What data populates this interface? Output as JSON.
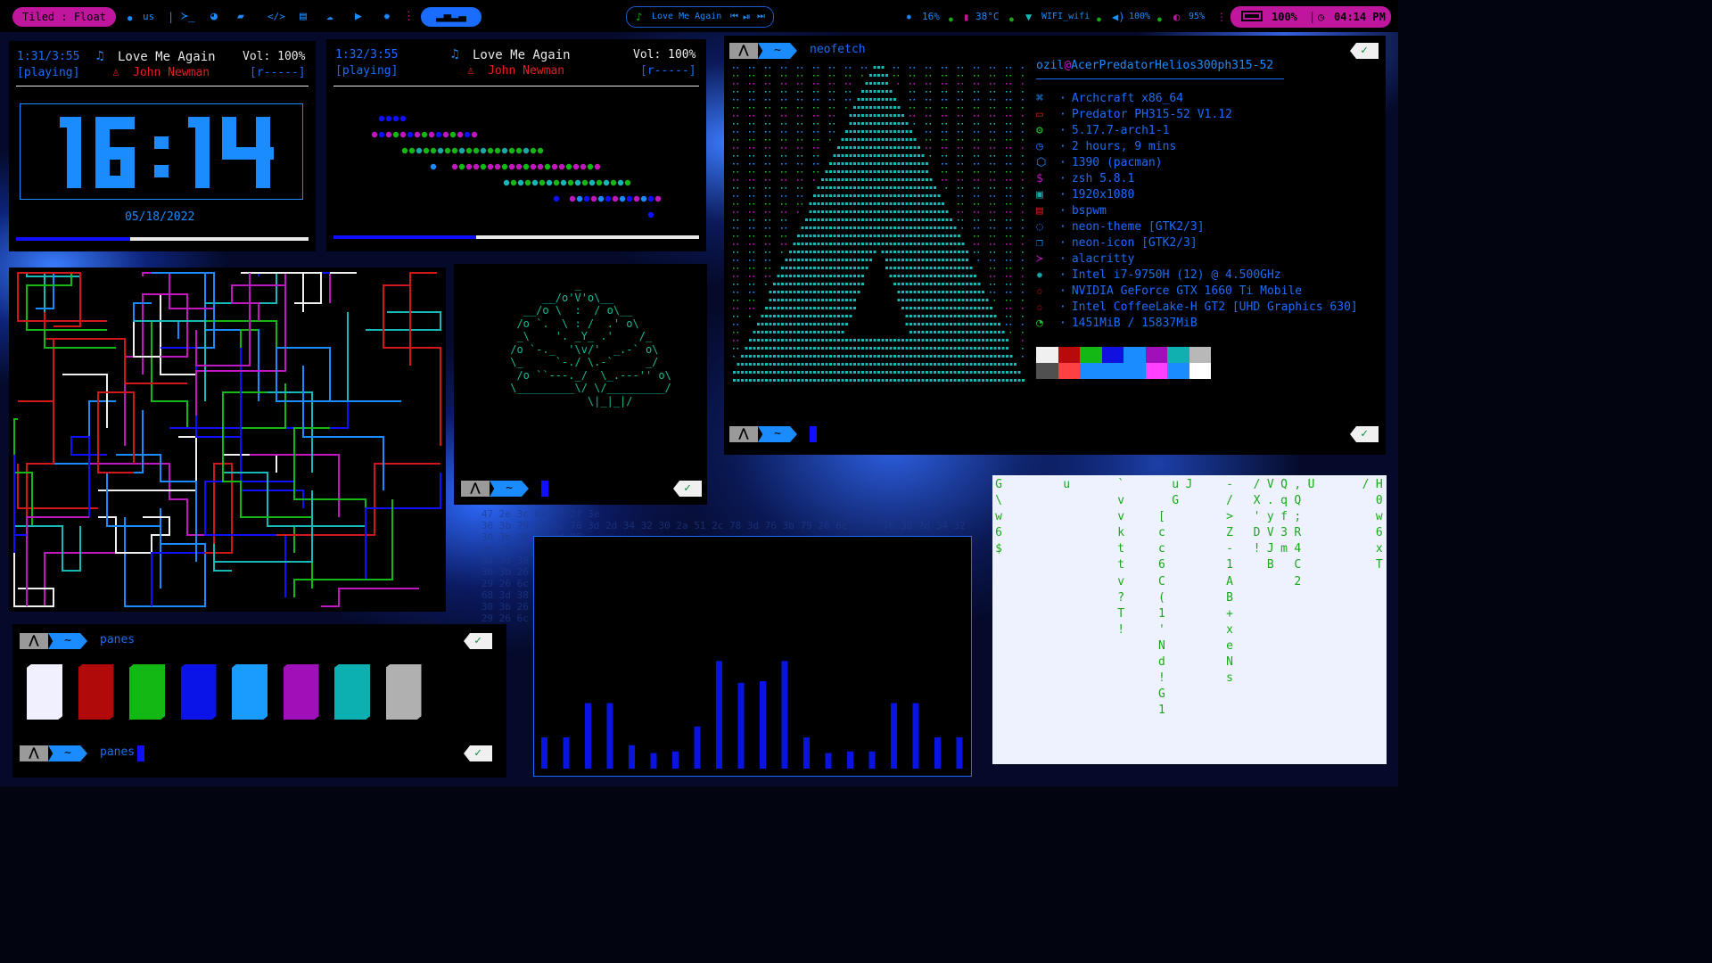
{
  "bar": {
    "layout_label": "Tiled : Float",
    "keyboard": "us",
    "now_playing": "Love Me Again",
    "cpu": "16%",
    "temp": "38°C",
    "wifi": "WIFI_wifi",
    "volume": "100%",
    "brightness": "95%",
    "battery": "100%",
    "clock": "04:14 PM",
    "accent": "#1a8cff",
    "highlight": "#c0169e"
  },
  "player1": {
    "time": "1:31/3:55",
    "state": "[playing]",
    "title": "Love Me Again",
    "artist": "John Newman",
    "volume": "Vol: 100%",
    "flags": "[r-----]",
    "progress": 0.39
  },
  "clock_widget": {
    "time": "16:14",
    "date": "05/18/2022"
  },
  "player2": {
    "time": "1:32/3:55",
    "state": "[playing]",
    "title": "Love Me Again",
    "artist": "John Newman",
    "volume": "Vol: 100%",
    "flags": "[r-----]",
    "progress": 0.39
  },
  "neofetch": {
    "command": "neofetch",
    "user_host_user": "ozil",
    "user_host_sep": "@",
    "user_host_host": "AcerPredatorHelios300ph315-52",
    "info": [
      {
        "icon": "⌘",
        "icon_name": "command-icon",
        "color": "#1a8cff",
        "value": "Archcraft x86_64"
      },
      {
        "icon": "▭",
        "icon_name": "laptop-icon",
        "color": "#d01818",
        "value": "Predator PH315-52 V1.12"
      },
      {
        "icon": "⚙",
        "icon_name": "kernel-gear-icon",
        "color": "#22c022",
        "value": "5.17.7-arch1-1"
      },
      {
        "icon": "◷",
        "icon_name": "uptime-clock-icon",
        "color": "#1a6cff",
        "value": "2 hours, 9 mins"
      },
      {
        "icon": "⬡",
        "icon_name": "package-icon",
        "color": "#1a8cff",
        "value": "1390 (pacman)"
      },
      {
        "icon": "$",
        "icon_name": "shell-icon",
        "color": "#c018c0",
        "value": "zsh 5.8.1"
      },
      {
        "icon": "▣",
        "icon_name": "resolution-icon",
        "color": "#18a8a8",
        "value": "1920x1080"
      },
      {
        "icon": "▤",
        "icon_name": "wm-icon",
        "color": "#d01818",
        "value": "bspwm"
      },
      {
        "icon": "◌",
        "icon_name": "theme-icon",
        "color": "#1a6cff",
        "value": "neon-theme [GTK2/3]"
      },
      {
        "icon": "❐",
        "icon_name": "icons-icon",
        "color": "#1a8cff",
        "value": "neon-icon [GTK2/3]"
      },
      {
        "icon": "≻",
        "icon_name": "terminal-icon",
        "color": "#c018c0",
        "value": "alacritty"
      },
      {
        "icon": "✹",
        "icon_name": "cpu-icon",
        "color": "#18a8a8",
        "value": "Intel i7-9750H (12) @ 4.500GHz"
      },
      {
        "icon": "✩",
        "icon_name": "gpu-icon",
        "color": "#d01818",
        "value": "NVIDIA GeForce GTX 1660 Ti Mobile"
      },
      {
        "icon": "✩",
        "icon_name": "gpu-icon",
        "color": "#d01818",
        "value": "Intel CoffeeLake-H GT2 [UHD Graphics 630]"
      },
      {
        "icon": "◔",
        "icon_name": "memory-icon",
        "color": "#22c022",
        "value": "1451MiB / 15837MiB"
      }
    ],
    "palette_top": [
      "#f0f0f0",
      "#b80a0a",
      "#14b814",
      "#1010e0",
      "#1a8cff",
      "#a010b8",
      "#10b0b0",
      "#b8b8b8"
    ],
    "palette_bottom": [
      "#505050",
      "#ff4040",
      "#1a8cff",
      "#1a8cff",
      "#1a8cff",
      "#ff40ff",
      "#1a8cff",
      "#ffffff"
    ]
  },
  "panes": {
    "command_top": "panes",
    "command_bottom": "panes",
    "colors": [
      "#f0f0ff",
      "#b00a0a",
      "#14b814",
      "#0a14e8",
      "#1a9cff",
      "#a010b8",
      "#0cb0b0",
      "#b0b0b0"
    ]
  },
  "prompt": {
    "arch_glyph": "⋀",
    "tilde": "~",
    "ok": "✓"
  },
  "visualizer": {
    "bars": [
      0.2,
      0.2,
      0.42,
      0.42,
      0.15,
      0.1,
      0.11,
      0.27,
      0.69,
      0.55,
      0.56,
      0.69,
      0.2,
      0.1,
      0.11,
      0.11,
      0.42,
      0.42,
      0.2,
      0.2
    ]
  },
  "matrix_rain": {
    "columns": [
      "G\\w6$",
      "",
      "",
      "",
      "",
      "u",
      "",
      "",
      "",
      "`vvkttv?T!",
      "",
      "",
      "  [cc6C(1'Nd!G1 ",
      "uG",
      "J",
      "",
      "",
      "-/>Z-1AB+xeNs",
      "",
      "/X'D!",
      "V.yVJB",
      "Qqf3m",
      ",Q;R4C2",
      "U",
      "",
      "",
      "",
      "/",
      "H0w6xT"
    ]
  }
}
